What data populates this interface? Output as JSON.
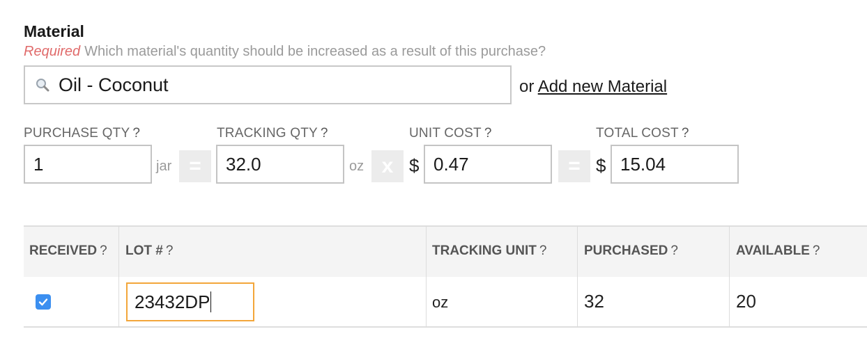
{
  "material": {
    "title": "Material",
    "required_label": "Required",
    "help_text": "Which material's quantity should be increased as a result of this purchase?",
    "search_value": "Oil - Coconut",
    "or_text": "or",
    "add_new_link": "Add new Material"
  },
  "costs": {
    "purchase_qty": {
      "label": "PURCHASE QTY",
      "help": "?",
      "value": "1",
      "unit": "jar"
    },
    "equals_symbol": "=",
    "tracking_qty": {
      "label": "TRACKING QTY",
      "help": "?",
      "value": "32.0",
      "unit": "oz"
    },
    "times_symbol": "x",
    "unit_cost": {
      "label": "UNIT COST",
      "help": "?",
      "currency": "$",
      "value": "0.47"
    },
    "total_cost": {
      "label": "TOTAL COST",
      "help": "?",
      "currency": "$",
      "value": "15.04"
    }
  },
  "table": {
    "headers": {
      "received": "RECEIVED",
      "lot": "LOT #",
      "tracking_unit": "TRACKING UNIT",
      "purchased": "PURCHASED",
      "available": "AVAILABLE",
      "help": "?"
    },
    "row": {
      "received_checked": true,
      "lot": "23432DP",
      "tracking_unit": "oz",
      "purchased": "32",
      "available": "20"
    }
  },
  "colors": {
    "required": "#e06a6a",
    "checkbox": "#3b8ff0",
    "focus_border": "#f3a63a"
  }
}
